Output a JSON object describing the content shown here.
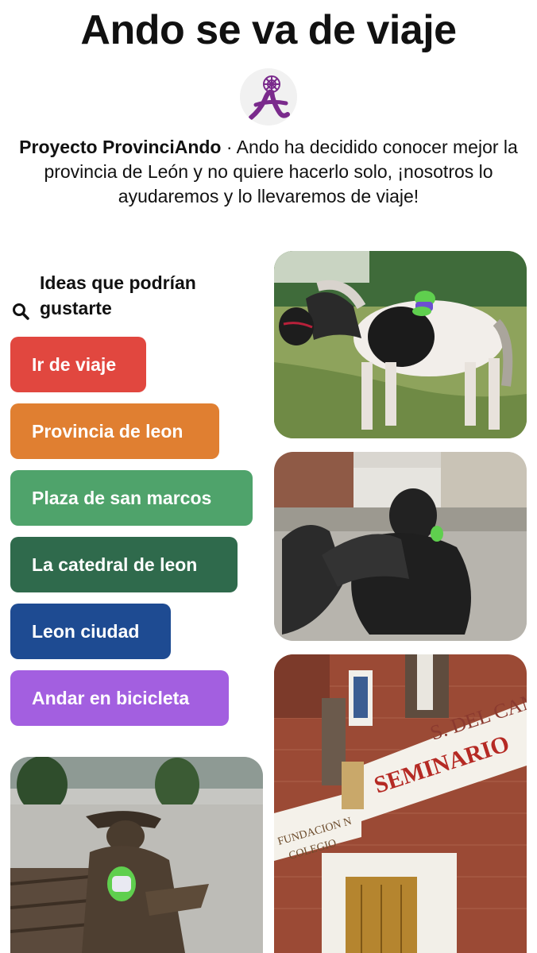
{
  "header": {
    "title": "Ando se va de viaje",
    "logo_icon": "provinciando-logo-icon",
    "description_name": "Proyecto ProvinciAndo",
    "description_separator": " · ",
    "description_text": "Ando ha decidido conocer mejor la provincia de León y no quiere hacerlo solo, ¡nosotros lo ayudaremos y lo llevaremos de viaje!"
  },
  "ideas": {
    "heading": "Ideas que podrían gustarte",
    "icon": "search-icon",
    "chips": [
      {
        "label": "Ir de viaje",
        "color": "#e1473f"
      },
      {
        "label": "Provincia de leon",
        "color": "#e07f31"
      },
      {
        "label": "Plaza de san marcos",
        "color": "#4fa36b"
      },
      {
        "label": "La catedral de leon",
        "color": "#2f6a4c"
      },
      {
        "label": "Leon ciudad",
        "color": "#1e4b92"
      },
      {
        "label": "Andar en bicicleta",
        "color": "#a35fe0"
      }
    ]
  },
  "pins": {
    "seminario_sign_line1": "S. DEL CAMIN",
    "seminario_sign_line2": "SEMINARIO",
    "fundacion_sign_line1": "FUNDACION N",
    "fundacion_sign_line2": "COLEGIO"
  },
  "colors": {
    "logo_purple": "#7a2a8c",
    "brick": "#9b4a35"
  }
}
